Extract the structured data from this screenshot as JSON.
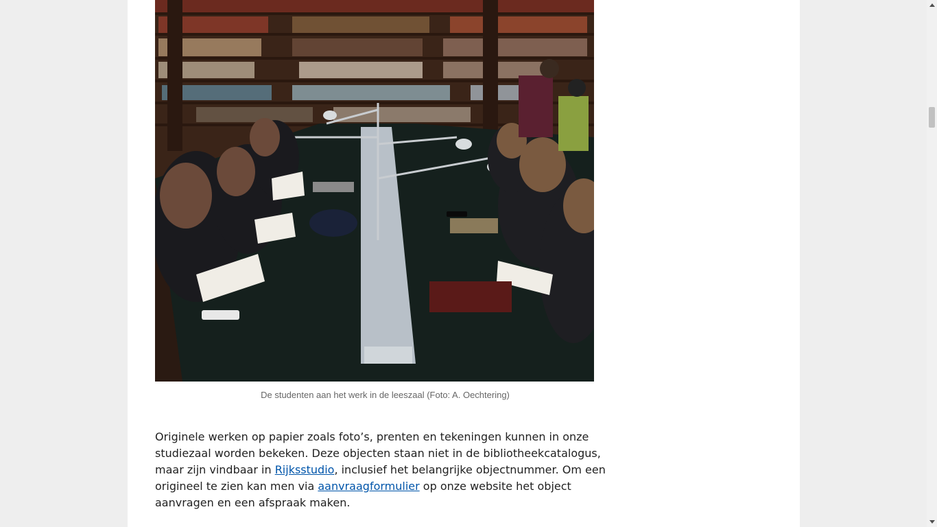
{
  "figure": {
    "image_alt": "Studenten in de leeszaal",
    "caption": "De studenten aan het werk in de leeszaal (Foto: A. Oechtering)"
  },
  "article": {
    "seg1": "Originele werken op papier zoals foto’s, prenten en tekeningen kunnen in onze studiezaal worden bekeken. Deze objecten staan niet in de bibliotheekcatalogus, maar zijn vindbaar in ",
    "link1": "Rijksstudio",
    "seg2": ", inclusief het belangrijke objectnummer. Om een origineel te zien kan men via ",
    "link2": "aanvraagformulier",
    "seg3": " op onze website het object aanvragen en een afspraak maken."
  },
  "colors": {
    "page_background": "#eeeeee",
    "content_background": "#ffffff",
    "link": "#0055aa",
    "caption_text": "#666666"
  },
  "icons": {
    "scroll_up": "triangle-up",
    "scroll_down": "triangle-down"
  }
}
